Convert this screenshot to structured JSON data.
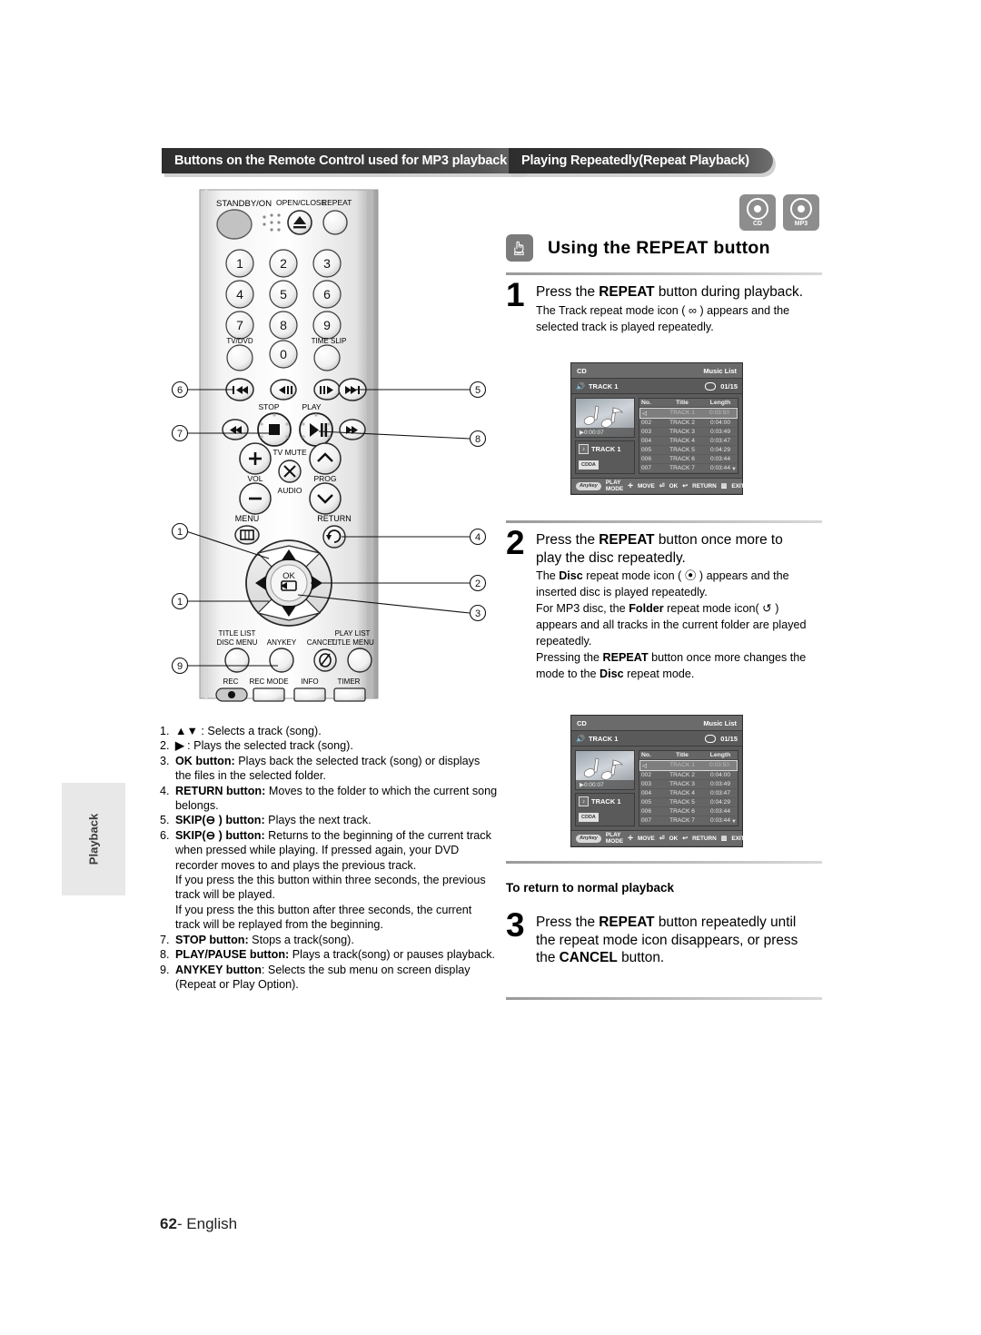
{
  "banners": {
    "left": "Buttons on the Remote Control used for MP3 playback",
    "right": "Playing Repeatedly(Repeat Playback)"
  },
  "media_badges": [
    {
      "label": "CD",
      "icon": "cd-disc-icon"
    },
    {
      "label": "MP3",
      "icon": "mp3-disc-icon"
    }
  ],
  "section": {
    "icon": "hand-press-icon",
    "title": "Using the REPEAT button"
  },
  "steps": [
    {
      "number": "1",
      "lead_parts": [
        "Press the ",
        "REPEAT",
        " button during playback."
      ],
      "body": [
        "The Track repeat mode icon ( ∞ ) appears and the",
        "selected track is played repeatedly."
      ]
    },
    {
      "number": "2",
      "lead_line1": "Press the REPEAT button once more to",
      "lead_line2": "play the disc repeatedly.",
      "body": [
        "The Disc repeat mode icon ( ⦿ ) appears and the",
        "inserted disc is played repeatedly.",
        "For MP3 disc, the Folder repeat mode icon( ↺ )",
        "appears and all tracks in the current folder are played",
        "repeatedly.",
        "Pressing the REPEAT button once more changes the",
        "mode to the Disc repeat mode."
      ]
    },
    {
      "number": "3",
      "lead_line1": "Press the REPEAT button repeatedly until",
      "lead_line2": "the repeat mode icon disappears, or press",
      "lead_line3": "the CANCEL button."
    }
  ],
  "return_heading": "To return to normal playback",
  "osd": {
    "source": "CD",
    "title_right": "Music List",
    "now_playing": "TRACK 1",
    "disc_icon": "cd-mini-icon",
    "track_counter": "01/15",
    "elapsed": "0:00:07",
    "panel_track": "TRACK 1",
    "format_badge": "CDDA",
    "columns": [
      "No.",
      "Title",
      "Length"
    ],
    "rows": [
      {
        "no": "001",
        "title": "TRACK 1",
        "length": "0:03:50",
        "selected": true
      },
      {
        "no": "002",
        "title": "TRACK 2",
        "length": "0:04:00",
        "selected": false
      },
      {
        "no": "003",
        "title": "TRACK 3",
        "length": "0:03:49",
        "selected": false
      },
      {
        "no": "004",
        "title": "TRACK 4",
        "length": "0:03:47",
        "selected": false
      },
      {
        "no": "005",
        "title": "TRACK 5",
        "length": "0:04:29",
        "selected": false
      },
      {
        "no": "006",
        "title": "TRACK 6",
        "length": "0:03:44",
        "selected": false
      },
      {
        "no": "007",
        "title": "TRACK 7",
        "length": "0:03:44",
        "selected": false
      }
    ],
    "footer": {
      "anykey_pill": "Anykey",
      "play_mode": "PLAY MODE",
      "move": "MOVE",
      "ok": "OK",
      "return": "RETURN",
      "exit": "EXIT"
    }
  },
  "remote": {
    "labels": {
      "standby": "STANDBY/ON",
      "open_close": "OPEN/CLOSE",
      "repeat": "REPEAT",
      "tv_dvd": "TV/DVD",
      "time_slip": "TIME SLIP",
      "stop": "STOP",
      "play": "PLAY",
      "vol": "VOL",
      "tv_mute": "TV MUTE",
      "audio": "AUDIO",
      "prog": "PROG",
      "menu": "MENU",
      "return": "RETURN",
      "ok": "OK",
      "title_list": "TITLE LIST",
      "disc_menu": "DISC MENU",
      "anykey": "ANYKEY",
      "cancel": "CANCEL",
      "play_list": "PLAY LIST",
      "title_menu": "TITLE MENU",
      "rec": "REC",
      "rec_mode": "REC MODE",
      "info": "INFO",
      "timer": "TIMER"
    },
    "keypad": [
      "1",
      "2",
      "3",
      "4",
      "5",
      "6",
      "7",
      "8",
      "9",
      "0"
    ],
    "callouts": [
      "1",
      "2",
      "3",
      "4",
      "5",
      "6",
      "7",
      "8",
      "9"
    ]
  },
  "legend": [
    {
      "n": "1.",
      "html": "<b>▲▼</b> : Selects a track (song)."
    },
    {
      "n": "2.",
      "html": "<b>▶</b> : Plays the selected track (song)."
    },
    {
      "n": "3.",
      "html": "<b>OK button:</b> Plays back the selected track (song) or displays the files in the selected folder."
    },
    {
      "n": "4.",
      "html": "<b>RETURN button:</b> Moves to the folder to which the current song belongs."
    },
    {
      "n": "5.",
      "html": "<b>SKIP(⊖ ) button:</b> Plays the next track."
    },
    {
      "n": "6.",
      "html": "<b>SKIP(⊖ ) button:</b> Returns to the beginning of the current track when pressed while playing. If pressed again, your DVD recorder moves to and plays the previous track.<br>If you press the this button within three seconds, the previous track will be played.<br>If you press the this button after three seconds, the current track will be replayed from the beginning."
    },
    {
      "n": "7.",
      "html": "<b>STOP button:</b> Stops a track(song)."
    },
    {
      "n": "8.",
      "html": "<b>PLAY/PAUSE button:</b> Plays a track(song) or pauses playback."
    },
    {
      "n": "9.",
      "html": "<b>ANYKEY button</b>: Selects the sub menu on screen display (Repeat or Play Option)."
    }
  ],
  "footer": {
    "page": "62",
    "language": "- English"
  },
  "side_tab": "Playback"
}
